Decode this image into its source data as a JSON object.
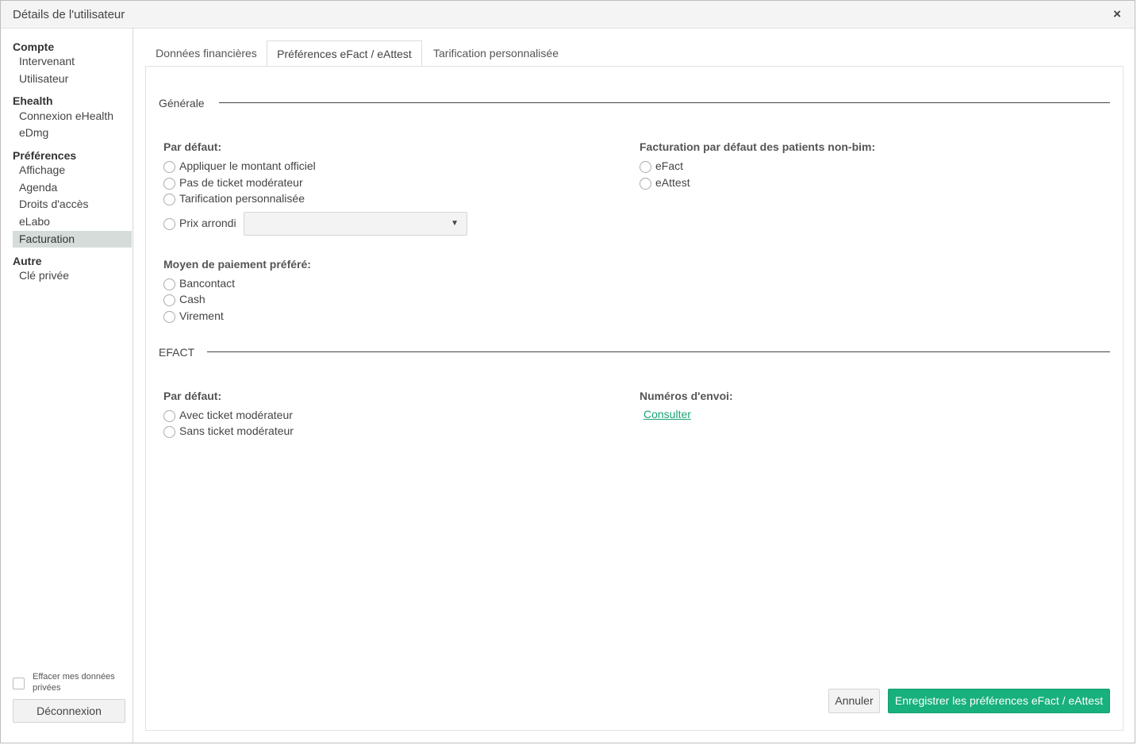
{
  "window": {
    "title": "Détails de l'utilisateur",
    "close_label": "×"
  },
  "sidebar": {
    "groups": [
      {
        "title": "Compte",
        "items": [
          "Intervenant",
          "Utilisateur"
        ]
      },
      {
        "title": "Ehealth",
        "items": [
          "Connexion eHealth",
          "eDmg"
        ]
      },
      {
        "title": "Préférences",
        "items": [
          "Affichage",
          "Agenda",
          "Droits d'accès",
          "eLabo",
          "Facturation"
        ]
      },
      {
        "title": "Autre",
        "items": [
          "Clé privée"
        ]
      }
    ],
    "active_item": "Facturation",
    "erase_label": "Effacer mes données privées",
    "logout_label": "Déconnexion"
  },
  "tabs": [
    {
      "label": "Données financières",
      "active": false
    },
    {
      "label": "Préférences eFact / eAttest",
      "active": true
    },
    {
      "label": "Tarification personnalisée",
      "active": false
    }
  ],
  "general": {
    "title": "Générale",
    "default_label": "Par défaut:",
    "default_options": [
      "Appliquer le montant officiel",
      "Pas de ticket modérateur",
      "Tarification personnalisée",
      "Prix arrondi"
    ],
    "rounded_price_value": "",
    "nonbim_label": "Facturation par défaut des patients non-bim:",
    "nonbim_options": [
      "eFact",
      "eAttest"
    ],
    "payment_label": "Moyen de paiement préféré:",
    "payment_options": [
      "Bancontact",
      "Cash",
      "Virement"
    ]
  },
  "efact": {
    "title": "EFACT",
    "default_label": "Par défaut:",
    "default_options": [
      "Avec ticket modérateur",
      "Sans ticket modérateur"
    ],
    "numbers_label": "Numéros d'envoi:",
    "consult_link": "Consulter"
  },
  "actions": {
    "cancel_label": "Annuler",
    "save_label": "Enregistrer les préférences eFact / eAttest"
  },
  "colors": {
    "accent": "#18b07c",
    "link": "#1aa374",
    "active_sidebar": "#d5dcda"
  }
}
